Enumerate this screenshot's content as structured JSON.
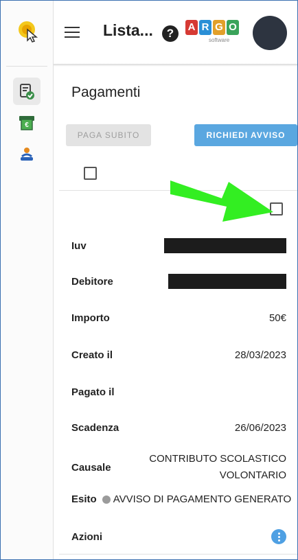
{
  "rail": {
    "logo_icon": "cursor-touch-logo-icon",
    "items": [
      {
        "icon": "document-check-icon",
        "active": true
      },
      {
        "icon": "payment-receipt-icon",
        "active": false
      },
      {
        "icon": "person-learning-icon",
        "active": false
      }
    ]
  },
  "appbar": {
    "title": "Lista...",
    "help_glyph": "?",
    "brand": {
      "letters": [
        "A",
        "R",
        "G",
        "O"
      ],
      "colors": [
        "#d63a34",
        "#2a8fd6",
        "#e2a02a",
        "#3aa35a"
      ],
      "subtitle": "software"
    }
  },
  "page": {
    "title": "Pagamenti",
    "paga_label": "PAGA SUBITO",
    "avviso_label": "RICHIEDI AVVISO"
  },
  "fields": {
    "iuv_label": "Iuv",
    "debitore_label": "Debitore",
    "importo_label": "Importo",
    "importo_value": "50€",
    "creato_label": "Creato il",
    "creato_value": "28/03/2023",
    "pagato_label": "Pagato il",
    "pagato_value": "",
    "scadenza_label": "Scadenza",
    "scadenza_value": "26/06/2023",
    "causale_label": "Causale",
    "causale_line1": "CONTRIBUTO SCOLASTICO",
    "causale_line2": "VOLONTARIO",
    "esito_label": "Esito",
    "esito_value": "AVVISO DI PAGAMENTO GENERATO",
    "azioni_label": "Azioni"
  },
  "colors": {
    "accent": "#5aa7e0",
    "arrow": "#33ee22",
    "status_dot": "#9b9b9b"
  }
}
